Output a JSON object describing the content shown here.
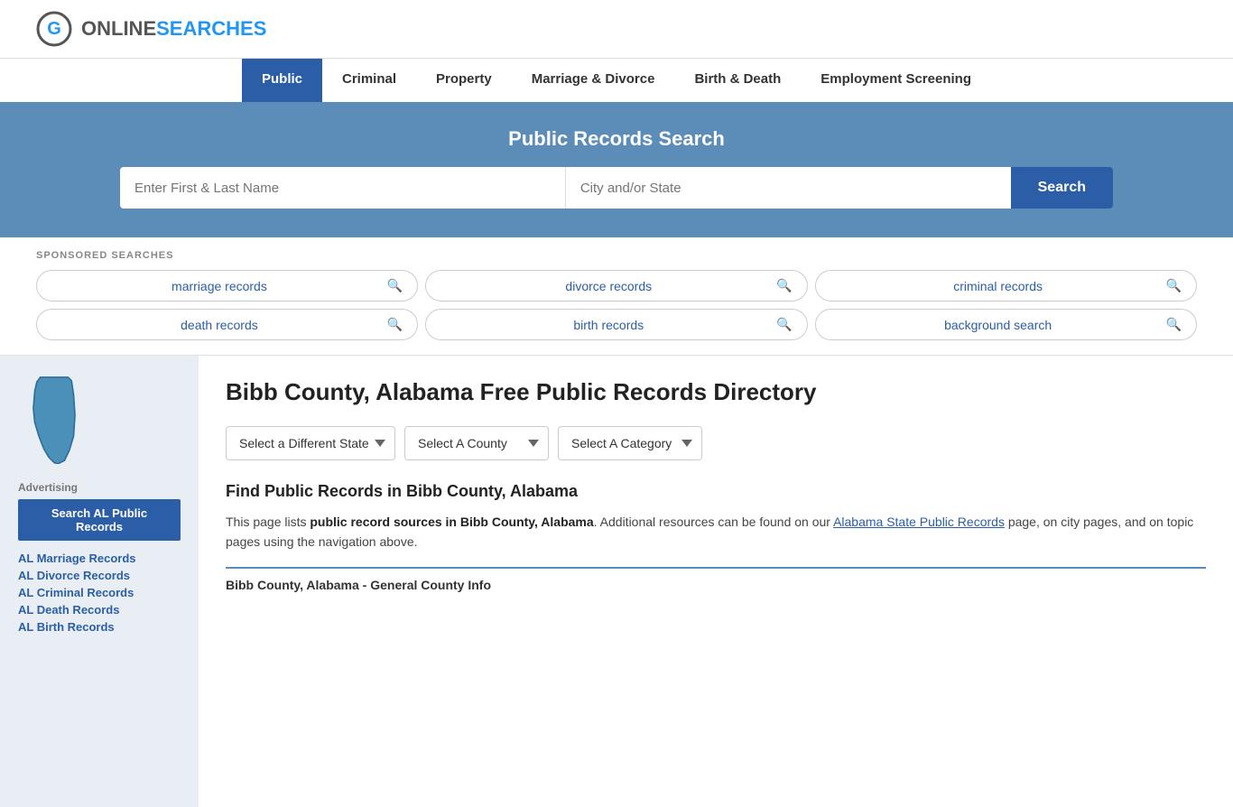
{
  "header": {
    "logo_text_online": "ONLINE",
    "logo_text_searches": "SEARCHES"
  },
  "nav": {
    "items": [
      {
        "label": "Public",
        "active": true
      },
      {
        "label": "Criminal",
        "active": false
      },
      {
        "label": "Property",
        "active": false
      },
      {
        "label": "Marriage & Divorce",
        "active": false
      },
      {
        "label": "Birth & Death",
        "active": false
      },
      {
        "label": "Employment Screening",
        "active": false
      }
    ]
  },
  "hero": {
    "title": "Public Records Search",
    "name_placeholder": "Enter First & Last Name",
    "city_placeholder": "City and/or State",
    "search_label": "Search"
  },
  "sponsored": {
    "label": "SPONSORED SEARCHES",
    "items": [
      {
        "text": "marriage records"
      },
      {
        "text": "divorce records"
      },
      {
        "text": "criminal records"
      },
      {
        "text": "death records"
      },
      {
        "text": "birth records"
      },
      {
        "text": "background search"
      }
    ]
  },
  "sidebar": {
    "advertising_label": "Advertising",
    "ad_btn_label": "Search AL Public Records",
    "links": [
      {
        "text": "AL Marriage Records"
      },
      {
        "text": "AL Divorce Records"
      },
      {
        "text": "AL Criminal Records"
      },
      {
        "text": "AL Death Records"
      },
      {
        "text": "AL Birth Records"
      }
    ]
  },
  "content": {
    "page_title": "Bibb County, Alabama Free Public Records Directory",
    "dropdown_state": "Select a Different State",
    "dropdown_county": "Select A County",
    "dropdown_category": "Select A Category",
    "find_title": "Find Public Records in Bibb County, Alabama",
    "description_part1": "This page lists ",
    "description_bold": "public record sources in Bibb County, Alabama",
    "description_part2": ". Additional resources can be found on our ",
    "description_link": "Alabama State Public Records",
    "description_part3": " page, on city pages, and on topic pages using the navigation above.",
    "county_info_title": "Bibb County, Alabama - General County Info"
  }
}
